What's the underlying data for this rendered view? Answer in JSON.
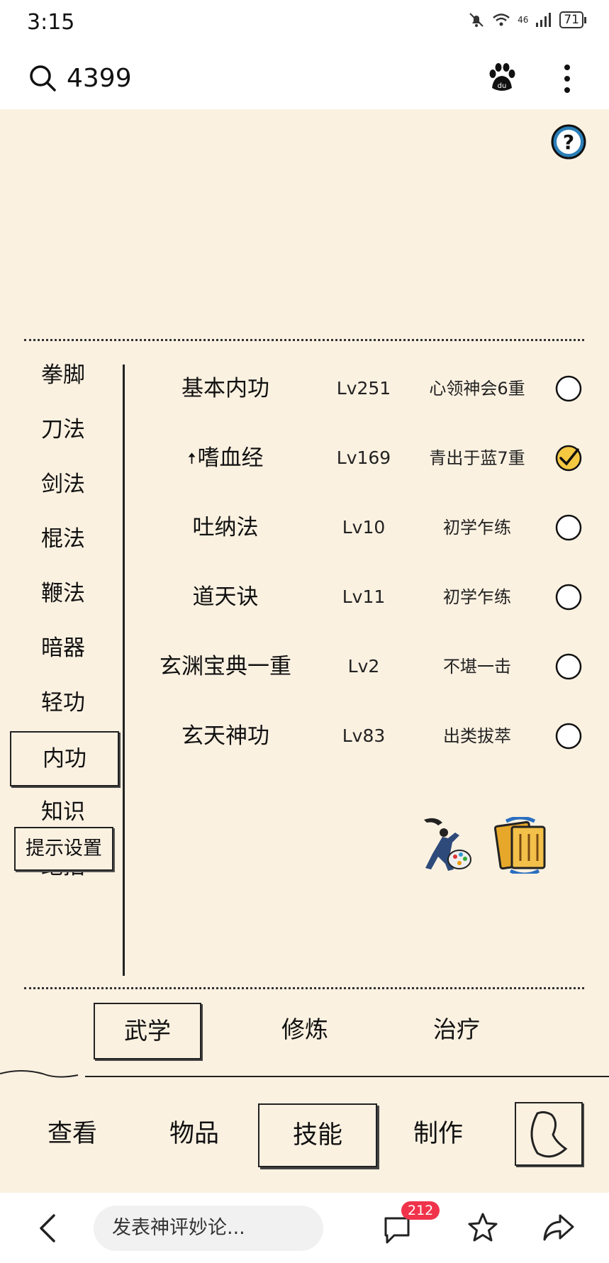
{
  "status_bar": {
    "time": "3:15",
    "network": "46",
    "battery": "71"
  },
  "search_bar": {
    "query": "4399"
  },
  "categories": [
    {
      "label": "拳脚",
      "active": false
    },
    {
      "label": "刀法",
      "active": false
    },
    {
      "label": "剑法",
      "active": false
    },
    {
      "label": "棍法",
      "active": false
    },
    {
      "label": "鞭法",
      "active": false
    },
    {
      "label": "暗器",
      "active": false
    },
    {
      "label": "轻功",
      "active": false
    },
    {
      "label": "内功",
      "active": true
    },
    {
      "label": "知识",
      "active": false
    },
    {
      "label": "绝招",
      "active": false
    }
  ],
  "hint_settings_label": "提示设置",
  "skills": [
    {
      "name": "基本内功",
      "level": "Lv251",
      "rank": "心领神会6重",
      "checked": false,
      "up_arrow": false
    },
    {
      "name": "嗜血经",
      "level": "Lv169",
      "rank": "青出于蓝7重",
      "checked": true,
      "up_arrow": true
    },
    {
      "name": "吐纳法",
      "level": "Lv10",
      "rank": "初学乍练",
      "checked": false,
      "up_arrow": false
    },
    {
      "name": "道天诀",
      "level": "Lv11",
      "rank": "初学乍练",
      "checked": false,
      "up_arrow": false
    },
    {
      "name": "玄渊宝典一重",
      "level": "Lv2",
      "rank": "不堪一击",
      "checked": false,
      "up_arrow": false
    },
    {
      "name": "玄天神功",
      "level": "Lv83",
      "rank": "出类拔萃",
      "checked": false,
      "up_arrow": false
    }
  ],
  "sub_tabs": [
    {
      "label": "武学",
      "active": true
    },
    {
      "label": "修炼",
      "active": false
    },
    {
      "label": "治疗",
      "active": false
    }
  ],
  "main_tabs": [
    {
      "label": "查看",
      "active": false
    },
    {
      "label": "物品",
      "active": false
    },
    {
      "label": "技能",
      "active": true
    },
    {
      "label": "制作",
      "active": false
    }
  ],
  "bottom_bar": {
    "comment_placeholder": "发表神评妙论...",
    "comment_count": "212"
  },
  "colors": {
    "game_bg": "#fbf1e1",
    "badge": "#f0334a",
    "help_blue": "#2a7fb8"
  }
}
